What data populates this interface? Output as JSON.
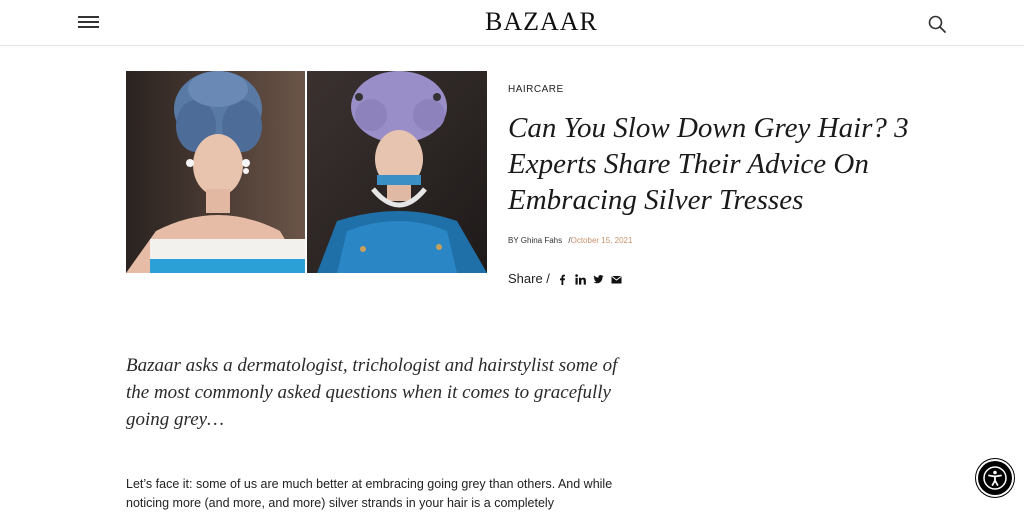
{
  "header": {
    "logo": "BAZAAR",
    "menu_icon": "hamburger-icon",
    "search_icon": "search-icon"
  },
  "hero": {
    "images": [
      "model-blue-wig-photo",
      "model-lilac-wig-photo"
    ]
  },
  "article": {
    "category": "HAIRCARE",
    "title": "Can You Slow Down Grey Hair? 3 Experts Share Their Advice On Embracing Silver Tresses",
    "byline_prefix": "BY",
    "author": "Ghina Fahs",
    "date_separator": "/",
    "date": "October 15, 2021",
    "share_label": "Share /",
    "share_icons": [
      "facebook-icon",
      "linkedin-icon",
      "twitter-icon",
      "email-icon"
    ],
    "dek": "Bazaar asks a dermatologist, trichologist and hairstylist some of the most commonly asked questions when it comes to gracefully going grey…",
    "body_first": "Let’s face it: some of us are much better at embracing going grey than others. And while noticing more (and more, and more) silver strands in your hair is a completely"
  },
  "colors": {
    "date_accent": "#c8906a",
    "text": "#222222",
    "divider": "#e4e4e4"
  },
  "widget": {
    "icon": "accessibility-icon"
  }
}
